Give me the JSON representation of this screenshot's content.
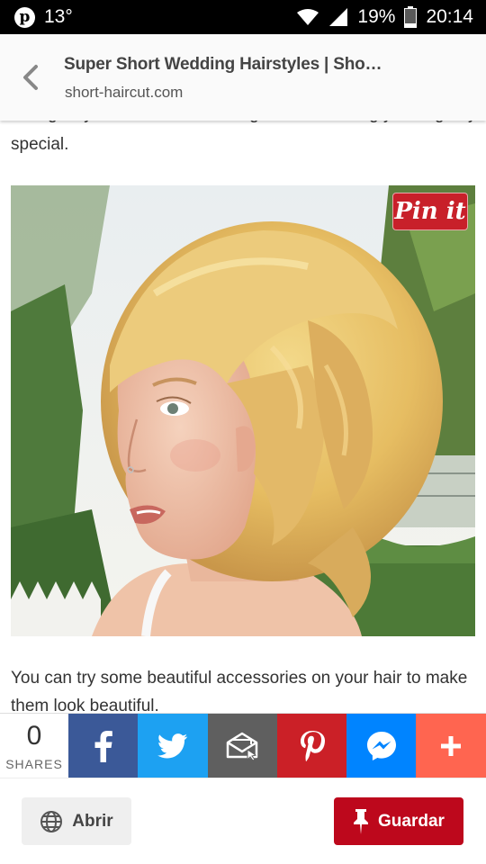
{
  "status": {
    "temperature": "13°",
    "battery": "19%",
    "time": "20:14"
  },
  "browser": {
    "page_title": "Super Short Wedding Hairstyles | Sho…",
    "domain": "short-haircut.com"
  },
  "article": {
    "text_before": "This give you a modern and elegant look making your big day special.",
    "pin_button_label": "Pin it",
    "text_after": "You can try some beautiful accessories on your hair to make them look beautiful."
  },
  "share": {
    "count": "0",
    "count_label": "SHARES",
    "buttons": [
      {
        "name": "facebook",
        "color": "#3b5998"
      },
      {
        "name": "twitter",
        "color": "#1da1f2"
      },
      {
        "name": "email",
        "color": "#5f5f5f"
      },
      {
        "name": "pinterest",
        "color": "#cb2027"
      },
      {
        "name": "messenger",
        "color": "#0084ff"
      },
      {
        "name": "more",
        "color": "#ff6550"
      }
    ]
  },
  "actions": {
    "open_label": "Abrir",
    "save_label": "Guardar"
  },
  "colors": {
    "status_bar": "#000000",
    "save_button": "#bd081c"
  }
}
